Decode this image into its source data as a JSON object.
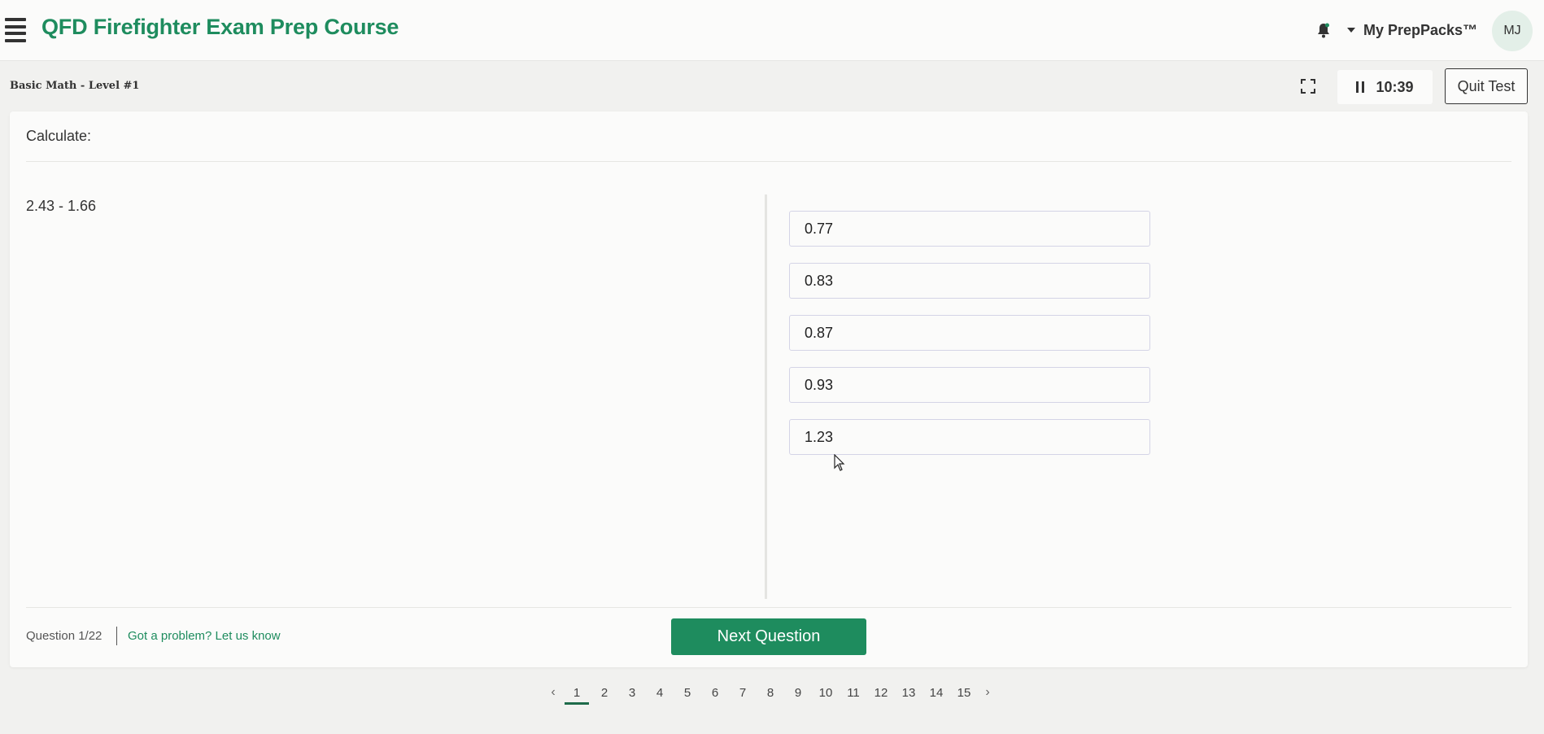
{
  "app": {
    "title": "QFD Firefighter Exam Prep Course",
    "brand_color": "#1e8c5e"
  },
  "header": {
    "menu_icon": "hamburger-icon",
    "notification_icon": "bell-icon",
    "packs_label": "My PrepPacks™",
    "user_initials": "MJ"
  },
  "test": {
    "title": "Basic Math - Level #1",
    "timer": "10:39",
    "quit_label": "Quit Test"
  },
  "question": {
    "prompt": "Calculate:",
    "text": "2.43 - 1.66",
    "options": [
      "0.77",
      "0.83",
      "0.87",
      "0.93",
      "1.23"
    ],
    "counter": "Question 1/22",
    "problem_link": "Got a problem? Let us know",
    "next_label": "Next Question"
  },
  "pagination": {
    "pages": [
      "1",
      "2",
      "3",
      "4",
      "5",
      "6",
      "7",
      "8",
      "9",
      "10",
      "11",
      "12",
      "13",
      "14",
      "15"
    ],
    "current": "1"
  }
}
